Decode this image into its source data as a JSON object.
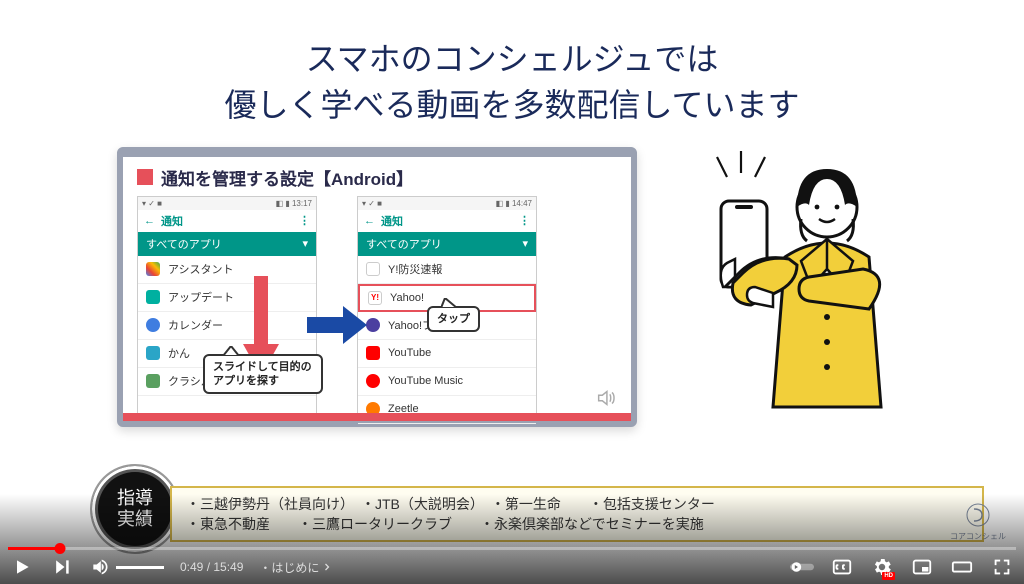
{
  "slide": {
    "title_line1": "スマホのコンシェルジュでは",
    "title_line2": "優しく学べる動画を多数配信しています",
    "panel_title": "通知を管理する設定【Android】",
    "callout_slide": "スライドして目的のアプリを探す",
    "callout_tap": "タップ",
    "phone1": {
      "time": "13:17",
      "nav": "通知",
      "tab": "すべてのアプリ",
      "apps": [
        "アシスタント",
        "アップデート",
        "カレンダー",
        "かん",
        "クラシル"
      ]
    },
    "phone2": {
      "time": "14:47",
      "nav": "通知",
      "tab": "すべてのアプリ",
      "apps": [
        "Y!防災速報",
        "Yahoo!",
        "Yahoo!フ",
        "YouTube",
        "YouTube Music",
        "Zeetle"
      ]
    }
  },
  "badge": {
    "line1": "指導",
    "line2": "実績"
  },
  "achievements": {
    "line1": "・三越伊勢丹（社員向け）　・JTB（大説明会）　・第一生命　　・包括支援センター",
    "line2": "・東急不動産　　・三鷹ロータリークラブ　　・永楽倶楽部などでセミナーを実施"
  },
  "branding": "コアコンシェル",
  "player": {
    "current": "0:49",
    "duration": "15:49",
    "chapter": "・はじめに",
    "hd": "HD",
    "progress_pct": 5.2
  }
}
